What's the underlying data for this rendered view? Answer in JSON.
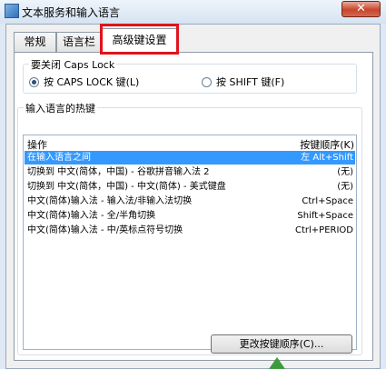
{
  "window": {
    "title": "文本服务和输入语言",
    "close_glyph": "✕"
  },
  "tabs": [
    {
      "label": "常规"
    },
    {
      "label": "语言栏"
    },
    {
      "label": "高级键设置"
    }
  ],
  "caps_lock": {
    "group_label": "要关闭 Caps Lock",
    "options": [
      {
        "label": "按 CAPS LOCK 键(L)",
        "checked": true
      },
      {
        "label": "按 SHIFT 键(F)",
        "checked": false
      }
    ]
  },
  "hotkeys": {
    "group_label": "输入语言的热键",
    "header_action": "操作",
    "header_sequence": "按键顺序(K)",
    "rows": [
      {
        "action": "在输入语言之间",
        "sequence": "左 Alt+Shift",
        "selected": true
      },
      {
        "action": "切换到 中文(简体，中国) - 谷歌拼音输入法 2",
        "sequence": "(无)"
      },
      {
        "action": "切换到 中文(简体，中国) - 中文(简体) - 美式键盘",
        "sequence": "(无)"
      },
      {
        "action": "中文(简体)输入法 - 输入法/非输入法切换",
        "sequence": "Ctrl+Space"
      },
      {
        "action": "中文(简体)输入法 - 全/半角切换",
        "sequence": "Shift+Space"
      },
      {
        "action": "中文(简体)输入法 - 中/英标点符号切换",
        "sequence": "Ctrl+PERIOD"
      }
    ]
  },
  "change_button": {
    "label": "更改按键顺序(C)..."
  }
}
